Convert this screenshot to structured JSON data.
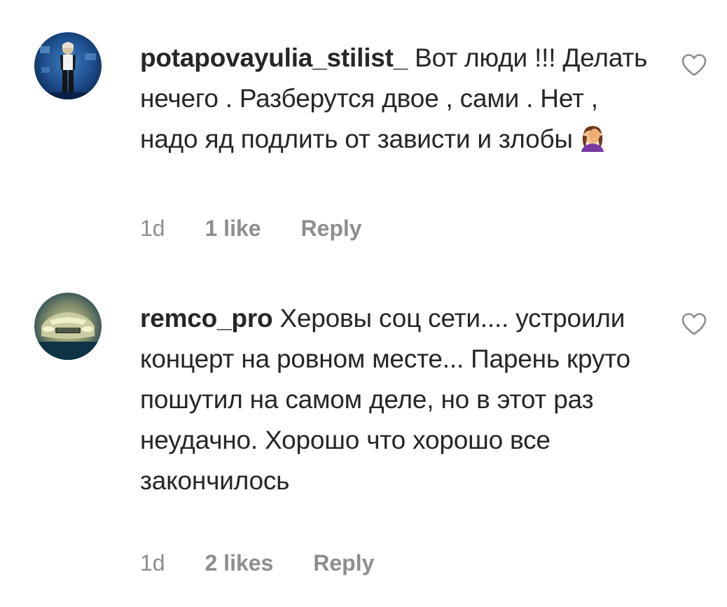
{
  "comments": [
    {
      "username": "potapovayulia_stilist_",
      "text": "Вот люди !!! Делать нечего . Разберутся двое , сами . Нет , надо яд подлить от зависти и злобы",
      "emoji": "face-palm-emoji",
      "time": "1d",
      "likes": "1 like",
      "reply_label": "Reply",
      "like_icon": "heart-outline-icon",
      "avatar_icon": "user-avatar"
    },
    {
      "username": "remco_pro",
      "text": "Херовы соц сети.... устроили концерт на ровном месте... Парень круто пошутил на самом деле, но в этот раз неудачно. Хорошо что хорошо все закончилось",
      "time": "1d",
      "likes": "2 likes",
      "reply_label": "Reply",
      "like_icon": "heart-outline-icon",
      "avatar_icon": "user-avatar"
    }
  ],
  "colors": {
    "text": "#262626",
    "secondary": "#8e8e8e",
    "heart_stroke": "#8e8e8e"
  }
}
